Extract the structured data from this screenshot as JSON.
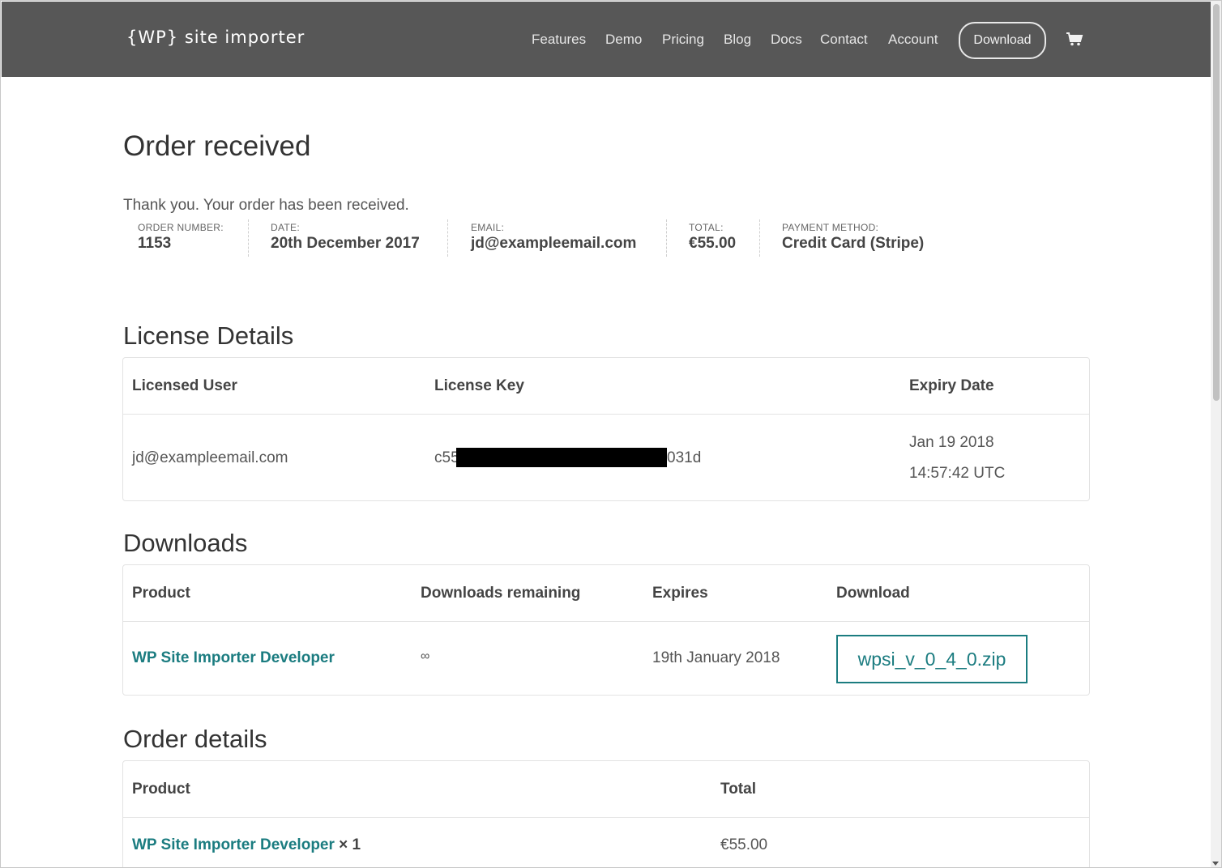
{
  "header": {
    "logo": "{WP} site importer",
    "nav": [
      "Features",
      "Demo",
      "Pricing",
      "Blog",
      "Docs",
      "Contact",
      "Account"
    ],
    "download_button": "Download"
  },
  "page": {
    "title": "Order received",
    "thank_you": "Thank you. Your order has been received."
  },
  "overview": {
    "order_number_label": "Order number:",
    "order_number": "1153",
    "date_label": "Date:",
    "date": "20th December 2017",
    "email_label": "Email:",
    "email": "jd@exampleemail.com",
    "total_label": "Total:",
    "total": "€55.00",
    "payment_label": "Payment method:",
    "payment": "Credit Card (Stripe)"
  },
  "license": {
    "heading": "License Details",
    "headers": [
      "Licensed User",
      "License Key",
      "Expiry Date"
    ],
    "user": "jd@exampleemail.com",
    "key_prefix": "c55",
    "key_suffix": "031d",
    "expiry_date": "Jan 19 2018",
    "expiry_time": "14:57:42 UTC"
  },
  "downloads": {
    "heading": "Downloads",
    "headers": [
      "Product",
      "Downloads remaining",
      "Expires",
      "Download"
    ],
    "product": "WP Site Importer Developer",
    "remaining": "∞",
    "expires": "19th January 2018",
    "file": "wpsi_v_0_4_0.zip"
  },
  "order_details": {
    "heading": "Order details",
    "headers": [
      "Product",
      "Total"
    ],
    "product": "WP Site Importer Developer",
    "quantity": "× 1",
    "total": "€55.00"
  },
  "colors": {
    "header_bg": "#575757",
    "accent": "#1b7c80"
  }
}
